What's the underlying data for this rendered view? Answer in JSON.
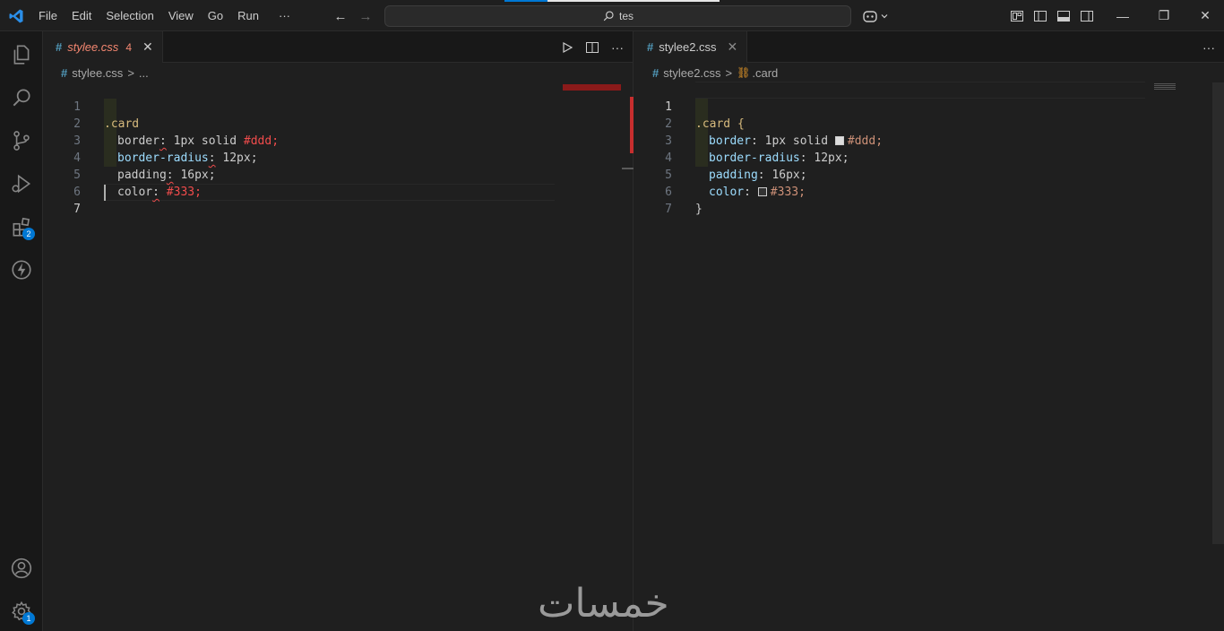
{
  "menu": [
    "File",
    "Edit",
    "Selection",
    "View",
    "Go",
    "Run",
    "···"
  ],
  "command_center": {
    "text": "tes"
  },
  "colors": {
    "accent": "#0078d4",
    "error": "#f14c4c",
    "bg": "#1f1f1f"
  },
  "activity_bar": {
    "extensions_badge": "2",
    "settings_badge": "1"
  },
  "left_editor": {
    "tab": {
      "title": "stylee.css",
      "problems": "4",
      "close": "✕"
    },
    "breadcrumb": {
      "file": "stylee.css",
      "sep": ">",
      "rest": "..."
    },
    "lines": [
      {
        "n": "1",
        "text": ".card"
      },
      {
        "n": "2",
        "a": "border",
        "b": ":",
        "c": " 1px solid ",
        "d": "#ddd;"
      },
      {
        "n": "3",
        "a": "border-radius",
        "b": ":",
        "c": " 12px;"
      },
      {
        "n": "4",
        "a": "padding",
        "b": ":",
        "c": " 16px;"
      },
      {
        "n": "5",
        "a": "color",
        "b": ":",
        "c": " ",
        "d": "#333;"
      },
      {
        "n": "6"
      },
      {
        "n": "7"
      }
    ],
    "actions": [
      "run-icon",
      "split-icon",
      "more-icon"
    ]
  },
  "right_editor": {
    "tab": {
      "title": "stylee2.css",
      "close": "✕"
    },
    "breadcrumb": {
      "file": "stylee2.css",
      "sep": ">",
      "symbol": ".card"
    },
    "lines": [
      {
        "n": "1",
        "text": ".card {"
      },
      {
        "n": "2",
        "a": "border",
        "b": ": 1px solid ",
        "d": "#ddd;"
      },
      {
        "n": "3",
        "a": "border-radius",
        "b": ": 12px;"
      },
      {
        "n": "4",
        "a": "padding",
        "b": ": 16px;"
      },
      {
        "n": "5",
        "a": "color",
        "b": ": ",
        "d": "#333;"
      },
      {
        "n": "6",
        "text": "}"
      },
      {
        "n": "7"
      }
    ],
    "actions": [
      "more-icon"
    ]
  },
  "watermark": "خمسات"
}
